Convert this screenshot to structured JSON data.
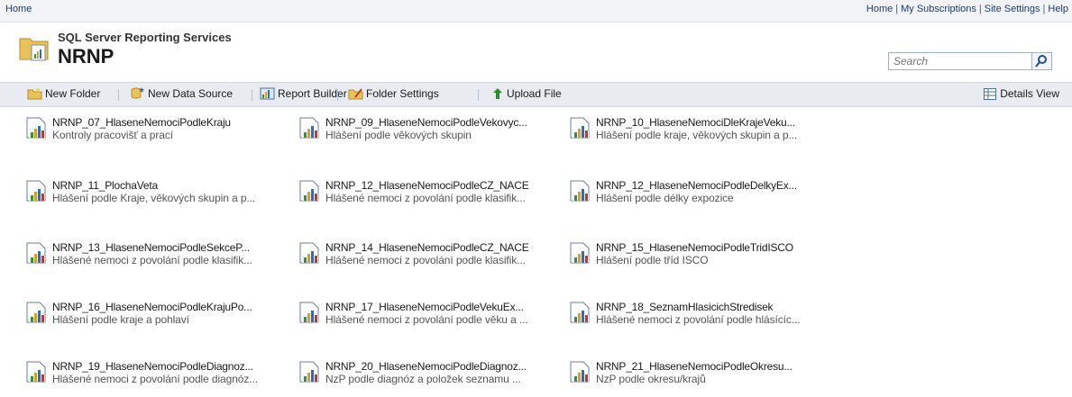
{
  "topbar": {
    "home_crumb": "Home",
    "links": [
      "Home",
      "My Subscriptions",
      "Site Settings",
      "Help"
    ],
    "separator": "|"
  },
  "header": {
    "product": "SQL Server Reporting Services",
    "title": "NRNP",
    "search_placeholder": "Search"
  },
  "toolbar": {
    "new_folder": "New Folder",
    "new_data_source": "New Data Source",
    "report_builder": "Report Builder",
    "folder_settings": "Folder Settings",
    "upload_file": "Upload File",
    "details_view": "Details View"
  },
  "reports": [
    {
      "name": "NRNP_07_HlaseneNemociPodleKraju",
      "desc": "Kontroly pracovišť a prací"
    },
    {
      "name": "NRNP_09_HlaseneNemociPodleVekovyc...",
      "desc": "Hlášení podle věkových skupin"
    },
    {
      "name": "NRNP_10_HlaseneNemociDleKrajeVeku...",
      "desc": "Hlášení podle kraje, věkových skupin a p..."
    },
    {
      "name": "NRNP_11_PlochaVeta",
      "desc": "Hlášení podle Kraje, věkových skupin a p..."
    },
    {
      "name": "NRNP_12_HlaseneNemociPodleCZ_NACE",
      "desc": "Hlášené nemoci z povolání podle klasifik..."
    },
    {
      "name": "NRNP_12_HlaseneNemociPodleDelkyEx...",
      "desc": "Hlášení podle délky expozice"
    },
    {
      "name": "NRNP_13_HlaseneNemociPodleSekceP...",
      "desc": "Hlášené nemoci z povolání podle klasifik..."
    },
    {
      "name": "NRNP_14_HlaseneNemociPodleCZ_NACE",
      "desc": "Hlášené nemoci z povolání podle klasifik..."
    },
    {
      "name": "NRNP_15_HlaseneNemociPodleTridISCO",
      "desc": "Hlášení podle tříd ISCO"
    },
    {
      "name": "NRNP_16_HlaseneNemociPodleKrajuPo...",
      "desc": "Hlášení podle kraje a pohlaví"
    },
    {
      "name": "NRNP_17_HlaseneNemociPodleVekuEx...",
      "desc": "Hlášené nemoci z povolání podle věku a ..."
    },
    {
      "name": "NRNP_18_SeznamHlasicichStredisek",
      "desc": "Hlášené nemoci z povolání podle hlásícíc..."
    },
    {
      "name": "NRNP_19_HlaseneNemociPodleDiagnoz...",
      "desc": "Hlášené nemoci z povolání podle diagnóz..."
    },
    {
      "name": "NRNP_20_HlaseneNemociPodleDiagnoz...",
      "desc": "NzP podle diagnóz a položek seznamu ..."
    },
    {
      "name": "NRNP_21_HlaseneNemociPodleOkresu...",
      "desc": "NzP podle okresu/krajů"
    }
  ]
}
